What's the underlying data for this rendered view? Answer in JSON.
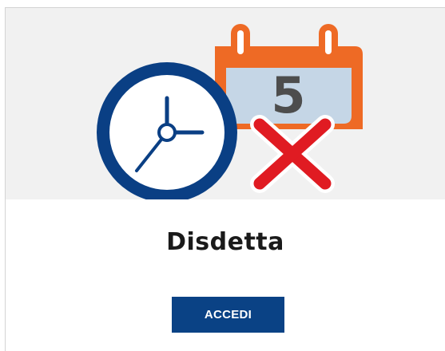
{
  "card": {
    "title": "Disdetta",
    "button_label": "ACCEDI",
    "illustration": {
      "calendar_day": "5",
      "icons": [
        "clock-icon",
        "calendar-icon",
        "cancel-x-icon"
      ]
    }
  },
  "colors": {
    "media_background": "#f1f1f1",
    "calendar_orange": "#ee6a25",
    "calendar_page": "#c5d6e6",
    "clock_navy": "#0a3f84",
    "cancel_red": "#e01b22",
    "button_blue": "#0a4285",
    "title_text": "#1a1a1a"
  }
}
